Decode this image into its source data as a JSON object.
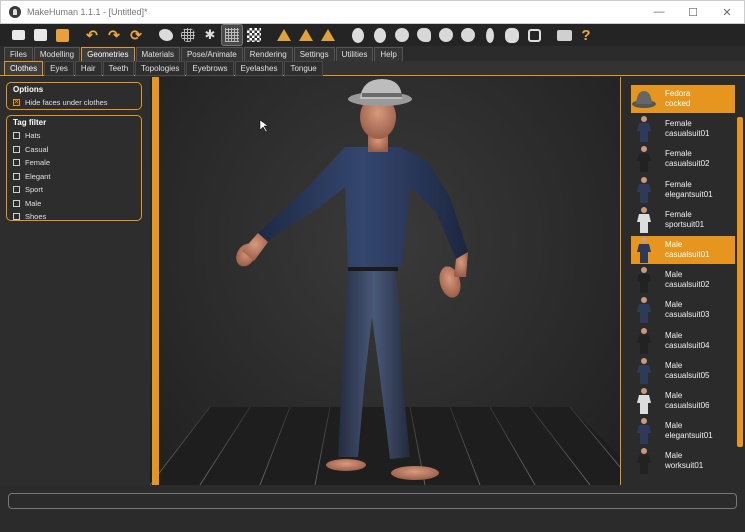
{
  "window": {
    "title": "MakeHuman 1.1.1 - [Untitled]*",
    "controls": [
      "minimize",
      "maximize",
      "close"
    ]
  },
  "toolbar": {
    "icons": [
      "new-icon",
      "save-icon",
      "export-icon",
      "undo-icon",
      "redo-icon",
      "reset-icon",
      "smooth-icon",
      "wireframe-icon",
      "pose-icon",
      "grid-icon",
      "checker-icon",
      "front-view-icon",
      "side-view-icon",
      "top-view-icon",
      "head-front-icon",
      "head-side-icon",
      "head-back-icon",
      "head-left-icon",
      "head-right-icon",
      "head-top-icon",
      "body-icon",
      "bodies-icon",
      "frame-icon",
      "screenshot-icon",
      "help-icon"
    ]
  },
  "menu": {
    "tabs": [
      "Files",
      "Modelling",
      "Geometries",
      "Materials",
      "Pose/Animate",
      "Rendering",
      "Settings",
      "Utilities",
      "Help"
    ],
    "active": "Geometries"
  },
  "subtabs": {
    "tabs": [
      "Clothes",
      "Eyes",
      "Hair",
      "Teeth",
      "Topologies",
      "Eyebrows",
      "Eyelashes",
      "Tongue"
    ],
    "active": "Clothes"
  },
  "options": {
    "title": "Options",
    "hide_faces_label": "Hide faces under clothes",
    "hide_faces_checked": true
  },
  "tag_filter": {
    "title": "Tag filter",
    "tags": [
      "Hats",
      "Casual",
      "Female",
      "Elegant",
      "Sport",
      "Male",
      "Shoes"
    ]
  },
  "clothes": [
    {
      "line1": "Fedora",
      "line2": "cocked",
      "selected": true
    },
    {
      "line1": "Female",
      "line2": "casualsuit01",
      "selected": false
    },
    {
      "line1": "Female",
      "line2": "casualsuit02",
      "selected": false
    },
    {
      "line1": "Female",
      "line2": "elegantsuit01",
      "selected": false
    },
    {
      "line1": "Female",
      "line2": "sportsuit01",
      "selected": false
    },
    {
      "line1": "Male",
      "line2": "casualsuit01",
      "selected": true
    },
    {
      "line1": "Male",
      "line2": "casualsuit02",
      "selected": false
    },
    {
      "line1": "Male",
      "line2": "casualsuit03",
      "selected": false
    },
    {
      "line1": "Male",
      "line2": "casualsuit04",
      "selected": false
    },
    {
      "line1": "Male",
      "line2": "casualsuit05",
      "selected": false
    },
    {
      "line1": "Male",
      "line2": "casualsuit06",
      "selected": false
    },
    {
      "line1": "Male",
      "line2": "elegantsuit01",
      "selected": false
    },
    {
      "line1": "Male",
      "line2": "worksuit01",
      "selected": false
    }
  ],
  "colors": {
    "accent": "#e6961e",
    "background": "#2b2b2b",
    "shirt": "#2c3a5c",
    "jeans": "#34405a",
    "skin": "#c98a6e",
    "hat": "#b8b8b8"
  }
}
